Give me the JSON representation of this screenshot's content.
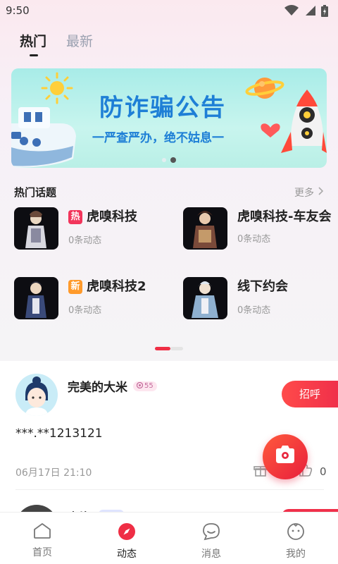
{
  "status_bar": {
    "time": "9:50"
  },
  "tabs": [
    {
      "label": "热门",
      "active": true
    },
    {
      "label": "最新",
      "active": false
    }
  ],
  "banner": {
    "title": "防诈骗公告",
    "subtitle": "一严查严办，绝不姑息一",
    "slide_count": 2,
    "active_slide": 2
  },
  "hot_topics": {
    "title": "热门话题",
    "more_label": "更多",
    "items": [
      {
        "name": "虎嗅科技",
        "badge": "热",
        "count": "0条动态"
      },
      {
        "name": "虎嗅科技-车友会",
        "badge": "",
        "count": "0条动态"
      },
      {
        "name": "虎嗅科技2",
        "badge": "新",
        "count": "0条动态"
      },
      {
        "name": "线下约会",
        "badge": "",
        "count": "0条动态"
      }
    ]
  },
  "post": {
    "username": "完美的大米",
    "level": "55",
    "greet_label": "招呼",
    "content": "***.**1213121",
    "time": "06月17日 21:10",
    "like_count": "0"
  },
  "next_post": {
    "username": "声片"
  },
  "bottom_nav": [
    {
      "label": "首页",
      "icon": "home-icon",
      "active": false
    },
    {
      "label": "动态",
      "icon": "compass-icon",
      "active": true
    },
    {
      "label": "消息",
      "icon": "message-icon",
      "active": false
    },
    {
      "label": "我的",
      "icon": "profile-icon",
      "active": false
    }
  ],
  "colors": {
    "accent": "#ef2e45",
    "banner_text": "#1e7fd6",
    "hot_badge": "#f2355b",
    "new_badge": "#ff9a2b"
  }
}
